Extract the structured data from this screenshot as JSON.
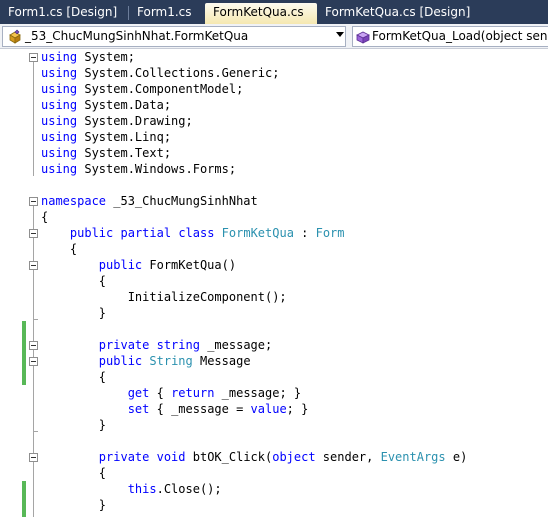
{
  "tabs": [
    {
      "label": "Form1.cs [Design]",
      "active": false
    },
    {
      "label": "Form1.cs",
      "active": false
    },
    {
      "label": "FormKetQua.cs",
      "active": true
    },
    {
      "label": "FormKetQua.cs [Design]",
      "active": false
    }
  ],
  "navbar": {
    "type_dropdown": "_53_ChucMungSinhNhat.FormKetQua",
    "member_dropdown": "FormKetQua_Load(object sender,"
  },
  "colors": {
    "tab_strip": "#2b3c59",
    "keyword": "#0000ff",
    "type_name": "#2b91af",
    "change_bar": "#58b857"
  },
  "icons": [
    "class-icon",
    "dropdown-arrow-icon",
    "method-icon",
    "collapse-icon"
  ],
  "code_lines": [
    [
      {
        "t": "using",
        "c": "kw"
      },
      {
        "t": " System;"
      }
    ],
    [
      {
        "t": "using",
        "c": "kw"
      },
      {
        "t": " System.Collections.Generic;"
      }
    ],
    [
      {
        "t": "using",
        "c": "kw"
      },
      {
        "t": " System.ComponentModel;"
      }
    ],
    [
      {
        "t": "using",
        "c": "kw"
      },
      {
        "t": " System.Data;"
      }
    ],
    [
      {
        "t": "using",
        "c": "kw"
      },
      {
        "t": " System.Drawing;"
      }
    ],
    [
      {
        "t": "using",
        "c": "kw"
      },
      {
        "t": " System.Linq;"
      }
    ],
    [
      {
        "t": "using",
        "c": "kw"
      },
      {
        "t": " System.Text;"
      }
    ],
    [
      {
        "t": "using",
        "c": "kw"
      },
      {
        "t": " System.Windows.Forms;"
      }
    ],
    [],
    [
      {
        "t": "namespace",
        "c": "kw"
      },
      {
        "t": " _53_ChucMungSinhNhat"
      }
    ],
    [
      {
        "t": "{"
      }
    ],
    [
      {
        "t": "    "
      },
      {
        "t": "public",
        "c": "kw"
      },
      {
        "t": " "
      },
      {
        "t": "partial",
        "c": "kw"
      },
      {
        "t": " "
      },
      {
        "t": "class",
        "c": "kw"
      },
      {
        "t": " "
      },
      {
        "t": "FormKetQua",
        "c": "ty"
      },
      {
        "t": " : "
      },
      {
        "t": "Form",
        "c": "ty"
      }
    ],
    [
      {
        "t": "    {"
      }
    ],
    [
      {
        "t": "        "
      },
      {
        "t": "public",
        "c": "kw"
      },
      {
        "t": " FormKetQua()"
      }
    ],
    [
      {
        "t": "        {"
      }
    ],
    [
      {
        "t": "            InitializeComponent();"
      }
    ],
    [
      {
        "t": "        }"
      }
    ],
    [],
    [
      {
        "t": "        "
      },
      {
        "t": "private",
        "c": "kw"
      },
      {
        "t": " "
      },
      {
        "t": "string",
        "c": "kw"
      },
      {
        "t": " _message;"
      }
    ],
    [
      {
        "t": "        "
      },
      {
        "t": "public",
        "c": "kw"
      },
      {
        "t": " "
      },
      {
        "t": "String",
        "c": "ty"
      },
      {
        "t": " Message"
      }
    ],
    [
      {
        "t": "        {"
      }
    ],
    [
      {
        "t": "            "
      },
      {
        "t": "get",
        "c": "kw"
      },
      {
        "t": " { "
      },
      {
        "t": "return",
        "c": "kw"
      },
      {
        "t": " _message; }"
      }
    ],
    [
      {
        "t": "            "
      },
      {
        "t": "set",
        "c": "kw"
      },
      {
        "t": " { _message = "
      },
      {
        "t": "value",
        "c": "kw"
      },
      {
        "t": "; }"
      }
    ],
    [
      {
        "t": "        }"
      }
    ],
    [],
    [
      {
        "t": "        "
      },
      {
        "t": "private",
        "c": "kw"
      },
      {
        "t": " "
      },
      {
        "t": "void",
        "c": "kw"
      },
      {
        "t": " btOK_Click("
      },
      {
        "t": "object",
        "c": "kw"
      },
      {
        "t": " sender, "
      },
      {
        "t": "EventArgs",
        "c": "ty"
      },
      {
        "t": " e)"
      }
    ],
    [
      {
        "t": "        {"
      }
    ],
    [
      {
        "t": "            "
      },
      {
        "t": "this",
        "c": "kw"
      },
      {
        "t": ".Close();"
      }
    ],
    [
      {
        "t": "        }"
      }
    ]
  ]
}
